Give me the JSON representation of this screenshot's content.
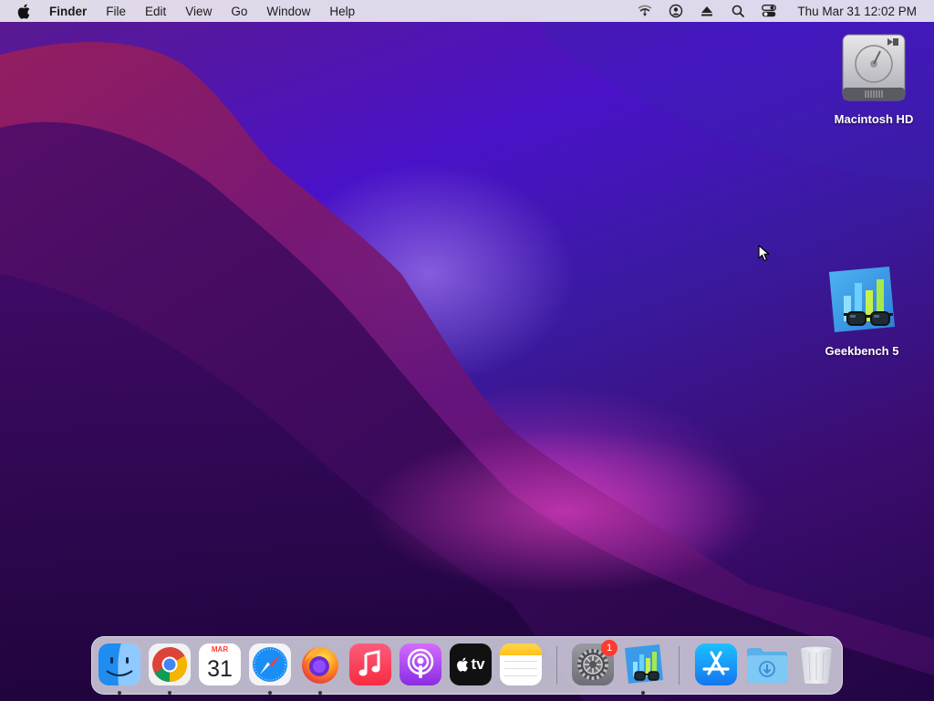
{
  "menubar": {
    "apple_icon": "apple-logo-icon",
    "app_name": "Finder",
    "menus": [
      "File",
      "Edit",
      "View",
      "Go",
      "Window",
      "Help"
    ],
    "status_icons": [
      "wifi-icon",
      "user-account-icon",
      "eject-icon",
      "search-icon",
      "control-center-icon"
    ],
    "clock": "Thu Mar 31  12:02 PM"
  },
  "desktop": {
    "icons": [
      {
        "name": "Macintosh HD",
        "icon": "hard-drive-icon"
      },
      {
        "name": "Geekbench 5",
        "icon": "geekbench-icon"
      }
    ]
  },
  "dock": {
    "apps": [
      {
        "name": "Finder",
        "icon": "finder-icon",
        "running": true
      },
      {
        "name": "Google Chrome",
        "icon": "chrome-icon",
        "running": true
      },
      {
        "name": "Calendar",
        "icon": "calendar-icon",
        "running": false,
        "month": "MAR",
        "day": "31"
      },
      {
        "name": "Safari",
        "icon": "safari-icon",
        "running": true
      },
      {
        "name": "Firefox",
        "icon": "firefox-icon",
        "running": true
      },
      {
        "name": "Music",
        "icon": "music-icon",
        "running": false
      },
      {
        "name": "Podcasts",
        "icon": "podcasts-icon",
        "running": false
      },
      {
        "name": "Apple TV",
        "icon": "apple-tv-icon",
        "running": false,
        "label": "tv"
      },
      {
        "name": "Notes",
        "icon": "notes-icon",
        "running": false
      },
      {
        "name": "System Preferences",
        "icon": "system-preferences-icon",
        "running": false,
        "badge": "1"
      },
      {
        "name": "Geekbench 5",
        "icon": "geekbench-icon",
        "running": true
      },
      {
        "name": "App Store",
        "icon": "app-store-icon",
        "running": false
      },
      {
        "name": "Downloads",
        "icon": "downloads-folder-icon",
        "running": false
      },
      {
        "name": "Trash",
        "icon": "trash-icon",
        "running": false
      }
    ]
  },
  "colors": {
    "menubar_bg": "#ECE9F0",
    "wallpaper_dark": "#24064a",
    "wallpaper_blue": "#4a12c8",
    "wallpaper_magenta": "#c0208a",
    "badge_red": "#ff3b30"
  }
}
